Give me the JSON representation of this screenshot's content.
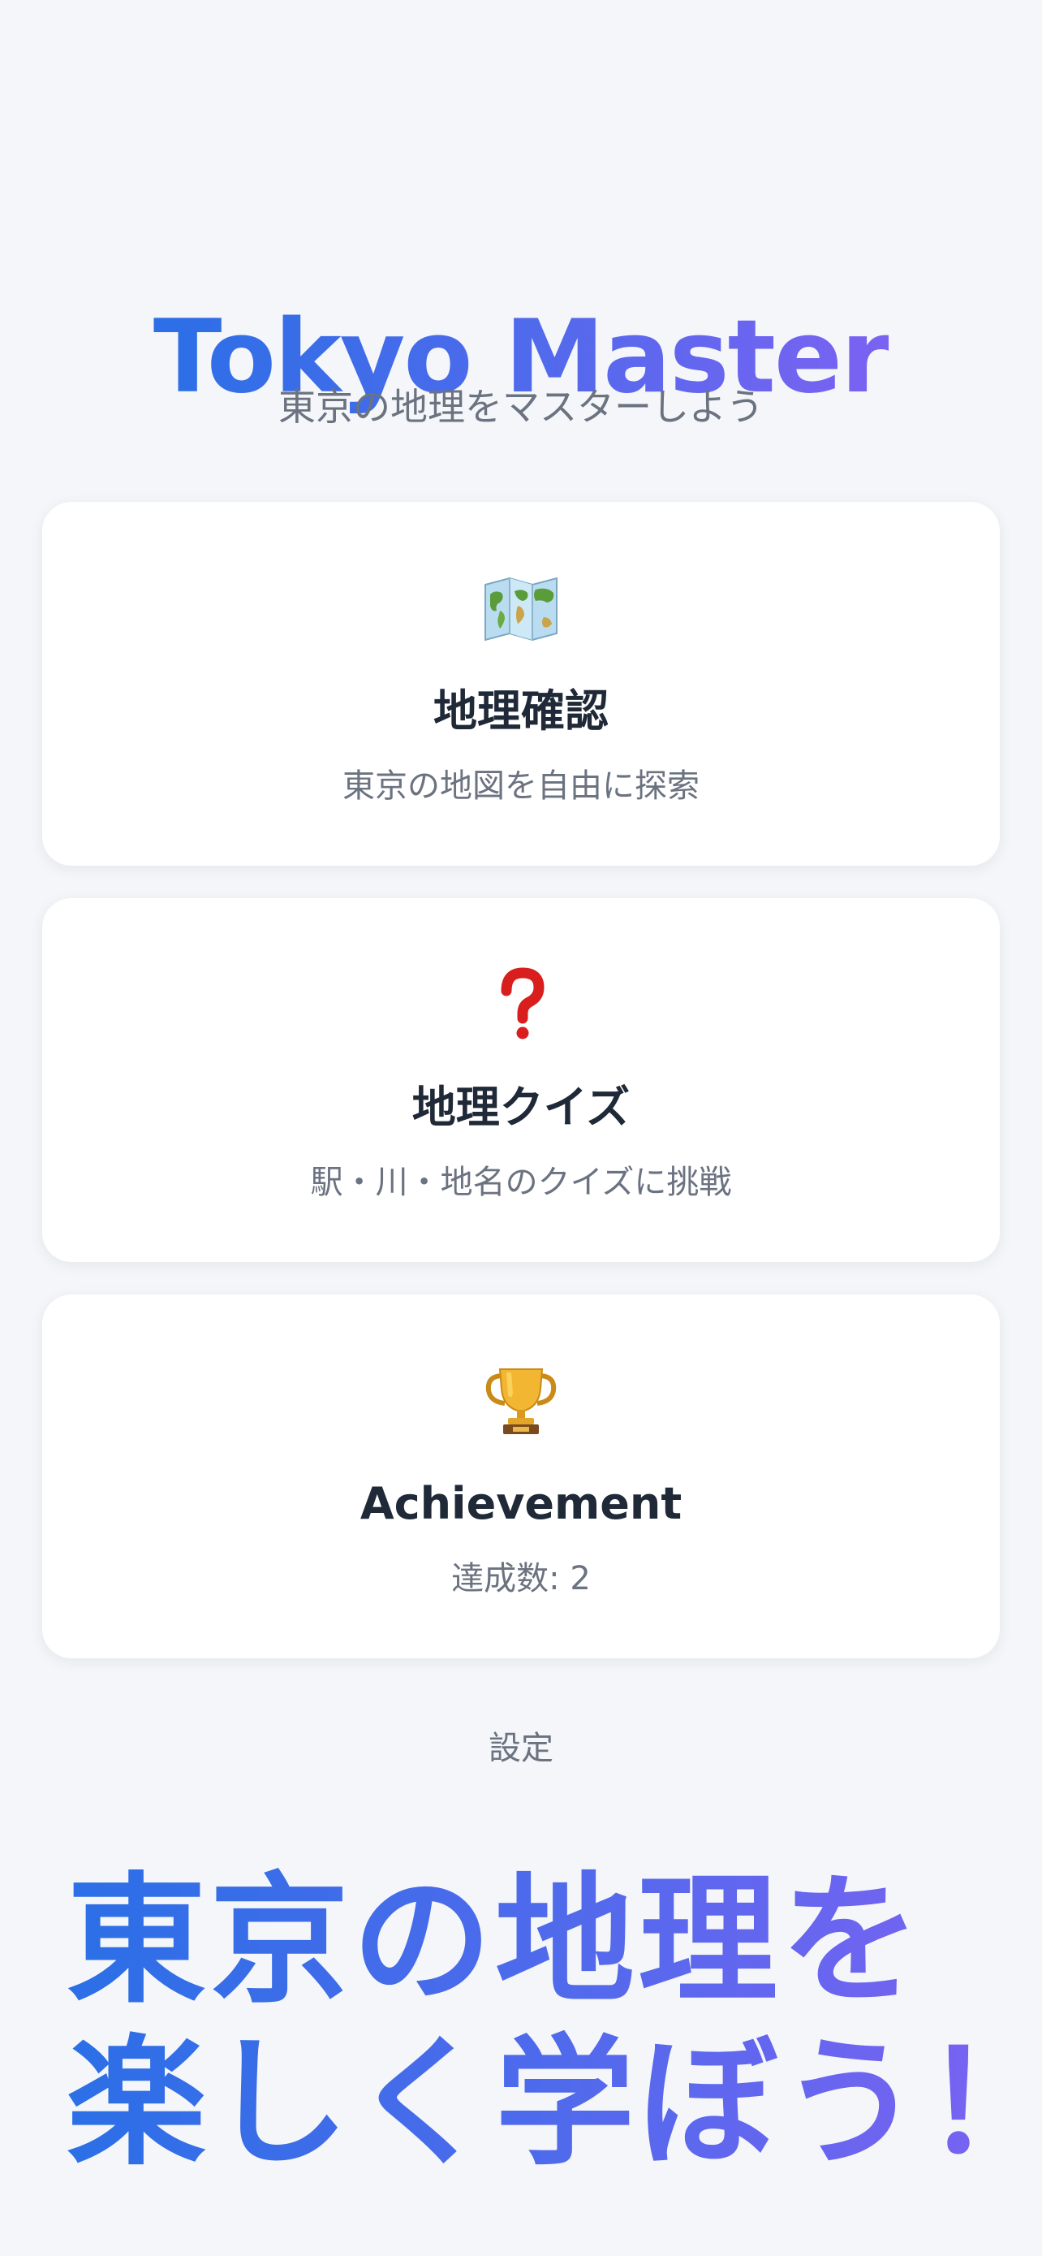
{
  "header": {
    "title": "Tokyo Master",
    "subtitle": "東京の地理をマスターしよう"
  },
  "menu": [
    {
      "icon": "map-icon",
      "title": "地理確認",
      "description": "東京の地図を自由に探索"
    },
    {
      "icon": "question-mark-icon",
      "title": "地理クイズ",
      "description": "駅・川・地名のクイズに挑戦"
    },
    {
      "icon": "trophy-icon",
      "title": "Achievement",
      "description": "達成数: 2"
    }
  ],
  "settings_label": "設定",
  "banner": {
    "line1": "東京の地理を",
    "line2": "楽しく学ぼう！"
  },
  "colors": {
    "gradient_start": "#2b6fe6",
    "gradient_end": "#7b62f2",
    "background": "#f4f6f9",
    "card": "#ffffff",
    "title_text": "#1f2937",
    "muted_text": "#6b7280",
    "question_red": "#d91e1e"
  }
}
